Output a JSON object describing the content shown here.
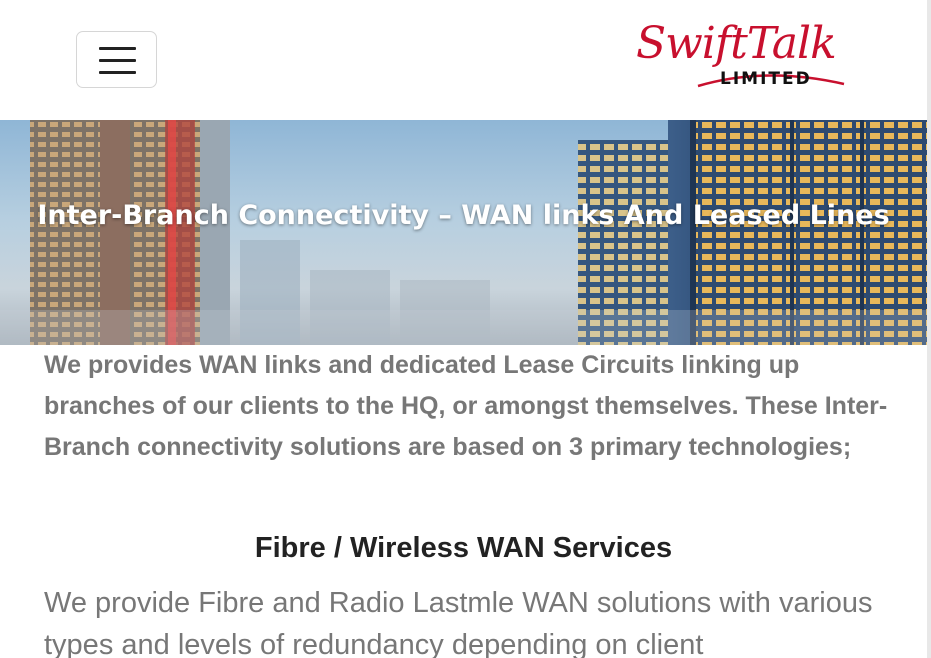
{
  "header": {
    "menu_icon": "hamburger-icon",
    "logo": {
      "main": "SwiftTalk",
      "sub": "LIMITED",
      "colors": {
        "main": "#c8102e",
        "sub": "#111111"
      }
    }
  },
  "hero": {
    "title": "Inter-Branch Connectivity – WAN links And Leased Lines"
  },
  "content": {
    "intro": "We provides WAN links and dedicated Lease Circuits linking up branches of our clients to the HQ, or amongst themselves. These Inter-Branch connectivity solutions are based on 3 primary technologies;",
    "section_title": "Fibre / Wireless WAN Services",
    "section_body": "We provide Fibre and Radio Lastmle WAN solutions with various types and levels of redundancy depending on client"
  },
  "colors": {
    "body_text": "#777777",
    "heading_text": "#222222",
    "brand": "#c8102e"
  }
}
